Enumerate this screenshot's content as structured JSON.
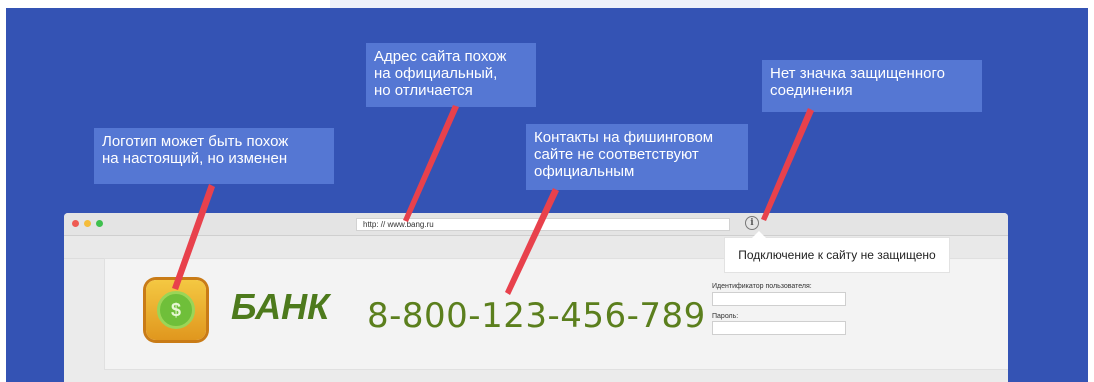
{
  "callouts": {
    "address": {
      "lines": [
        "Адрес сайта похож",
        "на официальный,",
        "но отличается"
      ]
    },
    "secure": {
      "lines": [
        "Нет значка защищенного",
        "соединения"
      ]
    },
    "logo": {
      "lines": [
        "Логотип может быть похож",
        "на настоящий, но изменен"
      ]
    },
    "contacts": {
      "lines": [
        "Контакты на фишинговом",
        "сайте не соответствуют",
        "официальным"
      ]
    }
  },
  "browser": {
    "url": "http: // www.bang.ru",
    "info_icon": "i",
    "security_popup": "Подключение к сайту не защищено"
  },
  "site": {
    "logo_symbol": "$",
    "bank_name": "БАНК",
    "phone": "8-800-123-456-789",
    "login": {
      "user_label": "Идентификатор пользователя:",
      "password_label": "Пароль:"
    }
  },
  "colors": {
    "background": "#3453b4",
    "callout": "#5577d3",
    "arrow": "#e8414c",
    "brand_green": "#4d7a1c"
  }
}
